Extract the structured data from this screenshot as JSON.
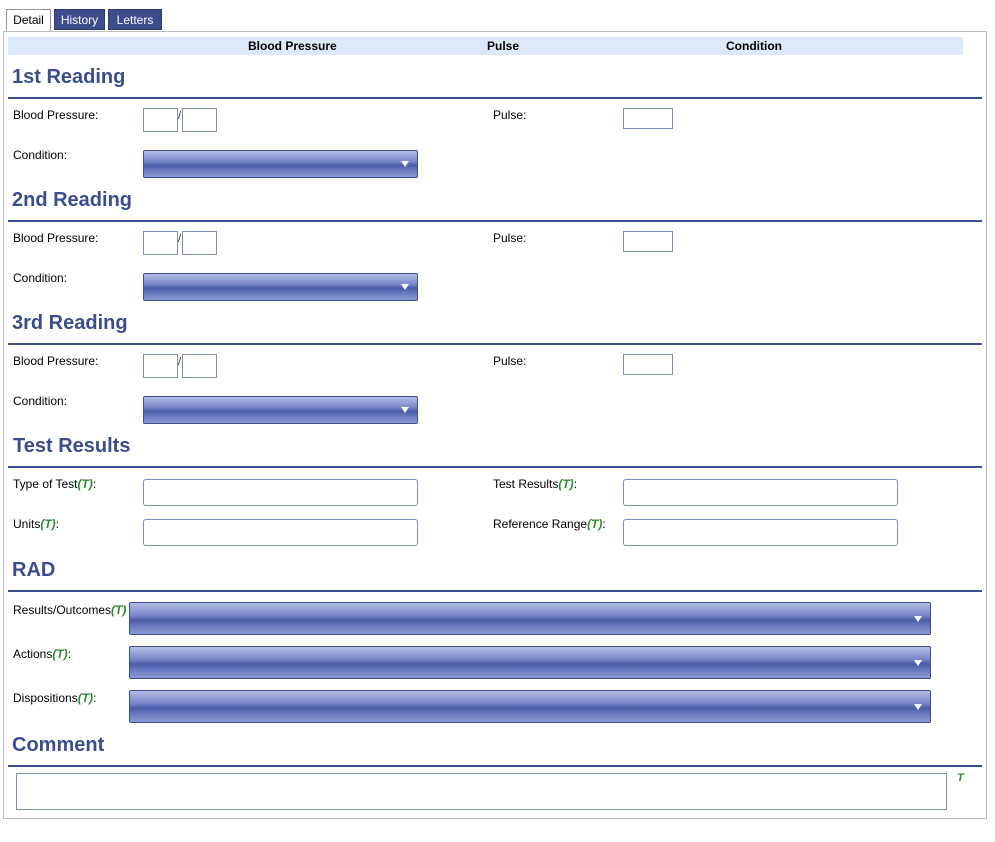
{
  "tabs": [
    {
      "label": "Detail",
      "active": true
    },
    {
      "label": "History",
      "active": false
    },
    {
      "label": "Letters",
      "active": false
    }
  ],
  "summary_header": {
    "col1": "Blood Pressure",
    "col2": "Pulse",
    "col3": "Condition"
  },
  "readings": [
    {
      "title": "1st Reading",
      "bp_label": "Blood Pressure:",
      "bp_separator": "/",
      "pulse_label": "Pulse:",
      "condition_label": "Condition:"
    },
    {
      "title": "2nd Reading",
      "bp_label": "Blood Pressure:",
      "bp_separator": "/",
      "pulse_label": "Pulse:",
      "condition_label": "Condition:"
    },
    {
      "title": "3rd Reading",
      "bp_label": "Blood Pressure:",
      "bp_separator": "/",
      "pulse_label": "Pulse:",
      "condition_label": "Condition:"
    }
  ],
  "test_results": {
    "title": "Test Results",
    "type_label": "Type of Test",
    "results_label": "Test Results",
    "units_label": "Units",
    "range_label": "Reference Range",
    "t_marker": "(T)",
    "colon": ":"
  },
  "rad": {
    "title": "RAD",
    "outcomes_label": "Results/Outcomes",
    "actions_label": "Actions",
    "dispositions_label": "Dispositions",
    "t_marker": "(T)",
    "colon": ":"
  },
  "comment": {
    "title": "Comment",
    "t_marker": "T"
  },
  "colors": {
    "accent": "#3b4d8c",
    "header_bar": "#dce9f8",
    "t_green": "#2e8b2e"
  }
}
